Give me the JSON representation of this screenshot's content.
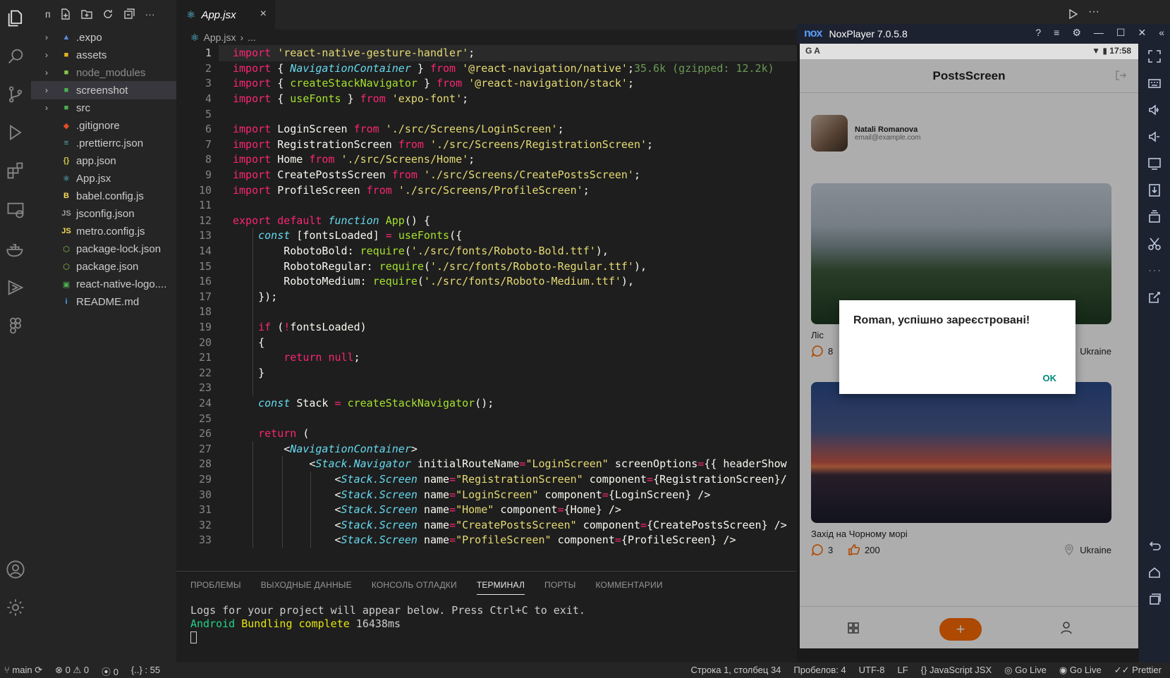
{
  "explorer": {
    "toolbar_label": "п",
    "items": [
      {
        "name": ".expo",
        "type": "folder",
        "chev": "›",
        "icon": "▲",
        "color": "#5a8ddc"
      },
      {
        "name": "assets",
        "type": "folder",
        "chev": "›",
        "icon": "■",
        "color": "#e6b422"
      },
      {
        "name": "node_modules",
        "type": "folder",
        "chev": "›",
        "icon": "■",
        "color": "#8bc34a"
      },
      {
        "name": "screenshot",
        "type": "folder",
        "chev": "›",
        "icon": "■",
        "color": "#4caf50"
      },
      {
        "name": "src",
        "type": "folder",
        "chev": "›",
        "icon": "■",
        "color": "#4caf50"
      },
      {
        "name": ".gitignore",
        "type": "file",
        "icon": "◆",
        "color": "#e44d26"
      },
      {
        "name": ".prettierrc.json",
        "type": "file",
        "icon": "≡",
        "color": "#56b3b4"
      },
      {
        "name": "app.json",
        "type": "file",
        "icon": "{}",
        "color": "#cbcb41"
      },
      {
        "name": "App.jsx",
        "type": "file",
        "icon": "⚛",
        "color": "#61dafb"
      },
      {
        "name": "babel.config.js",
        "type": "file",
        "icon": "B",
        "color": "#f5da55"
      },
      {
        "name": "jsconfig.json",
        "type": "file",
        "icon": "JS",
        "color": "#9e9e9e"
      },
      {
        "name": "metro.config.js",
        "type": "file",
        "icon": "JS",
        "color": "#f5da55"
      },
      {
        "name": "package-lock.json",
        "type": "file",
        "icon": "⬡",
        "color": "#8bc34a"
      },
      {
        "name": "package.json",
        "type": "file",
        "icon": "⬡",
        "color": "#8bc34a"
      },
      {
        "name": "react-native-logo....",
        "type": "file",
        "icon": "▣",
        "color": "#4caf50"
      },
      {
        "name": "README.md",
        "type": "file",
        "icon": "i",
        "color": "#42a5f5"
      }
    ]
  },
  "tab": {
    "label": "App.jsx",
    "close": "×"
  },
  "breadcrumb": {
    "file": "App.jsx",
    "sep": "›",
    "rest": "..."
  },
  "code": {
    "lines": [
      "import 'react-native-gesture-handler';",
      "import { NavigationContainer } from '@react-navigation/native';",
      "import { createStackNavigator } from '@react-navigation/stack';",
      "import { useFonts } from 'expo-font';",
      "",
      "import LoginScreen from './src/Screens/LoginScreen';",
      "import RegistrationScreen from './src/Screens/RegistrationScreen';",
      "import Home from './src/Screens/Home';",
      "import CreatePostsScreen from './src/Screens/CreatePostsScreen';",
      "import ProfileScreen from './src/Screens/ProfileScreen';",
      "",
      "export default function App() {",
      "    const [fontsLoaded] = useFonts({",
      "        RobotoBold: require('./src/fonts/Roboto-Bold.ttf'),",
      "        RobotoRegular: require('./src/fonts/Roboto-Regular.ttf'),",
      "        RobotoMedium: require('./src/fonts/Roboto-Medium.ttf'),",
      "    });",
      "",
      "    if (!fontsLoaded)",
      "    {",
      "        return null;",
      "    }",
      "",
      "    const Stack = createStackNavigator();",
      "",
      "    return (",
      "        <NavigationContainer>",
      "            <Stack.Navigator initialRouteName=\"LoginScreen\" screenOptions={{ headerShow",
      "                <Stack.Screen name=\"RegistrationScreen\" component={RegistrationScreen}/",
      "                <Stack.Screen name=\"LoginScreen\" component={LoginScreen} />",
      "                <Stack.Screen name=\"Home\" component={Home} />",
      "                <Stack.Screen name=\"CreatePostsScreen\" component={CreatePostsScreen} />",
      "                <Stack.Screen name=\"ProfileScreen\" component={ProfileScreen} />"
    ],
    "import_cost_hint": "35.6k (gzipped: 12.2k)"
  },
  "panel": {
    "tabs": [
      "ПРОБЛЕМЫ",
      "ВЫХОДНЫЕ ДАННЫЕ",
      "КОНСОЛЬ ОТЛАДКИ",
      "ТЕРМИНАЛ",
      "ПОРТЫ",
      "КОММЕНТАРИИ"
    ],
    "active_tab": "ТЕРМИНАЛ",
    "terminal": {
      "line1": "Logs for your project will appear below. Press Ctrl+C to exit.",
      "line2_a": "Android",
      "line2_b": " Bundling ",
      "line2_c": "complete",
      "line2_d": " 16438ms"
    }
  },
  "statusbar": {
    "branch": "main",
    "errors": "0",
    "warnings": "0",
    "ports": "0",
    "braces": "{..} : 55",
    "position": "Строка 1, столбец 34",
    "spaces": "Пробелов: 4",
    "encoding": "UTF-8",
    "eol": "LF",
    "language": "JavaScript JSX",
    "golive1": "Go Live",
    "golive2": "Go Live",
    "prettier": "Prettier"
  },
  "nox": {
    "logo": "nox",
    "title": "NoxPlayer 7.0.5.8",
    "time": "17:58",
    "status_left": "G A"
  },
  "app": {
    "header": "PostsScreen",
    "user_name": "Natali Romanova",
    "user_email": "email@example.com",
    "posts": [
      {
        "title": "Ліс",
        "comments": "8",
        "likes": "",
        "location": "Ukraine"
      },
      {
        "title": "Захід на Чорному морі",
        "comments": "3",
        "likes": "200",
        "location": "Ukraine"
      }
    ],
    "add_label": "+",
    "dialog_message": "Roman, успішно зареєстровані!",
    "dialog_ok": "OK"
  },
  "colors": {
    "accent": "#ff6c00",
    "dialog_ok": "#00897b"
  }
}
